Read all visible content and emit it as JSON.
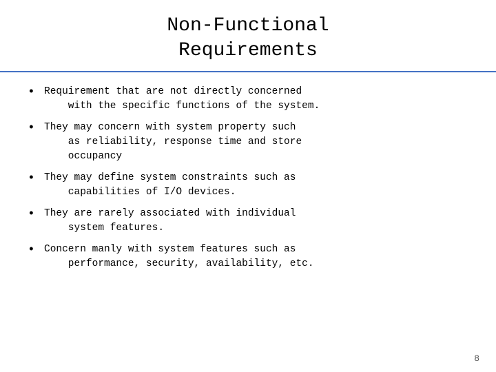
{
  "slide": {
    "title_line1": "Non-Functional",
    "title_line2": "Requirements",
    "bullets": [
      {
        "id": "bullet-1",
        "text": "Requirement that are not directly concerned\n    with the specific functions of the system."
      },
      {
        "id": "bullet-2",
        "text": "They may concern with system property such\n    as reliability, response time and store\n    occupancy"
      },
      {
        "id": "bullet-3",
        "text": "They may define system constraints such as\n    capabilities of I/O devices."
      },
      {
        "id": "bullet-4",
        "text": "They are rarely associated with individual\n    system features."
      },
      {
        "id": "bullet-5",
        "text": "Concern manly with system features such as\n    performance, security, availability, etc."
      }
    ],
    "page_number": "8"
  }
}
